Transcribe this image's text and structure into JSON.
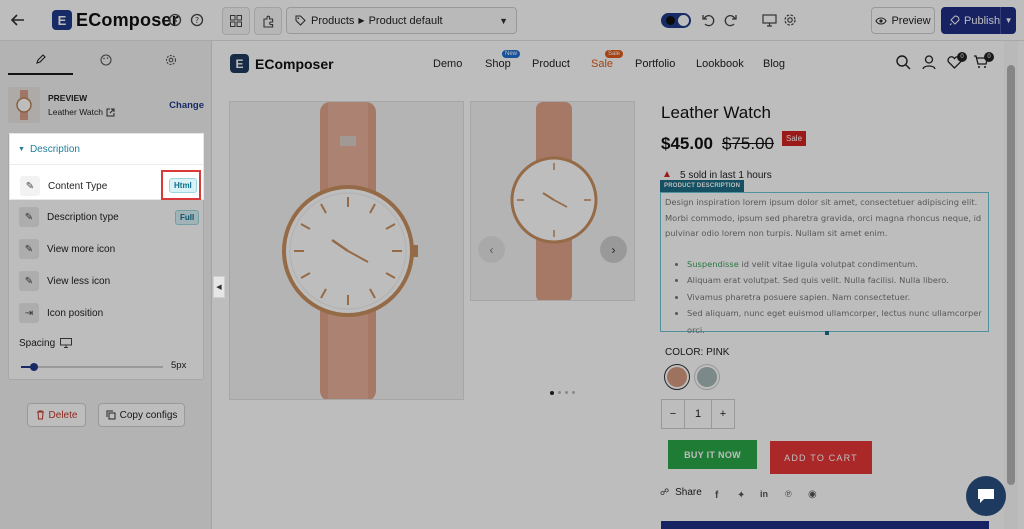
{
  "app": {
    "brand": "EComposer",
    "page_selector": {
      "category": "Products",
      "value": "Product default"
    },
    "preview_label": "Preview",
    "publish_label": "Publish"
  },
  "sidebar": {
    "preview": {
      "label": "PREVIEW",
      "product": "Leather Watch",
      "change_label": "Change"
    },
    "section_title": "Description",
    "settings": [
      {
        "label": "Content Type",
        "value": "Html"
      },
      {
        "label": "Description type",
        "value": "Full"
      },
      {
        "label": "View more icon"
      },
      {
        "label": "View less icon"
      },
      {
        "label": "Icon position"
      }
    ],
    "spacing": {
      "label": "Spacing",
      "value": "5px",
      "level": 0.08
    },
    "delete_label": "Delete",
    "copy_label": "Copy configs"
  },
  "store": {
    "brand": "EComposer",
    "nav": [
      {
        "label": "Demo"
      },
      {
        "label": "Shop",
        "badge": "New",
        "badge_color": "#1f6fd1"
      },
      {
        "label": "Product"
      },
      {
        "label": "Sale",
        "badge": "Sale",
        "badge_color": "#e05a1a"
      },
      {
        "label": "Portfolio"
      },
      {
        "label": "Lookbook"
      },
      {
        "label": "Blog"
      }
    ],
    "wishlist_count": "0",
    "cart_count": "0"
  },
  "product": {
    "title": "Leather Watch",
    "price": "$45.00",
    "compare_price": "$75.00",
    "sale_badge": "Sale",
    "sold_text": "5 sold in last 1 hours",
    "description_label": "PRODUCT DESCRIPTION",
    "description_paragraph": "Design inspiration lorem ipsum dolor sit amet, consectetuer adipiscing elit. Morbi commodo, ipsum sed pharetra gravida, orci magna rhoncus neque, id pulvinar odio lorem non turpis. Nullam sit amet enim.",
    "bullets": [
      {
        "highlight": "Suspendisse",
        "text": " id velit vitae ligula volutpat condimentum."
      },
      {
        "highlight": "",
        "text": "Aliquam erat volutpat. Sed quis velit. Nulla facilisi. Nulla libero."
      },
      {
        "highlight": "",
        "text": "Vivamus pharetra posuere sapien. Nam consectetuer."
      },
      {
        "highlight": "",
        "text": "Sed aliquam, nunc eget euismod ullamcorper, lectus nunc ullamcorper orci."
      }
    ],
    "color_label": "COLOR: PINK",
    "swatches": [
      "#d59a7f",
      "#a7b9b8"
    ],
    "quantity": "1",
    "buy_now_label": "BUY IT NOW",
    "add_to_cart_label": "ADD TO CART",
    "share_label": "Share"
  },
  "colors": {
    "accent": "#1f3a8a",
    "teal": "#1e6e86",
    "sale_red": "#e63737",
    "buy_green": "#2aa847",
    "strap": "#e0a48c"
  }
}
